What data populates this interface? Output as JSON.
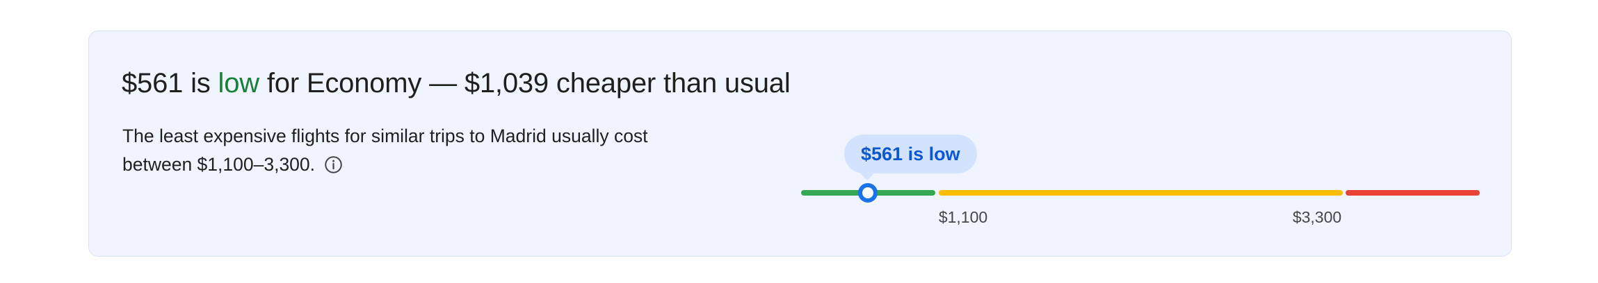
{
  "headline": {
    "price": "$561",
    "connector": "is",
    "level": "low",
    "rest": "for Economy — $1,039 cheaper than usual",
    "level_color": "#188038"
  },
  "description": "The least expensive flights for similar trips to Madrid usually cost between $1,100–3,300.",
  "info_icon": "info-circle-icon",
  "meter": {
    "bubble_label": "$561 is low",
    "marker_value": 561,
    "range_min": 1100,
    "range_max": 3300,
    "tick_labels": [
      "$1,100",
      "$3,300"
    ],
    "segment_colors": {
      "low": "#34a853",
      "typical": "#fbbc04",
      "high": "#ea4335"
    },
    "marker_color": "#1a73e8"
  }
}
